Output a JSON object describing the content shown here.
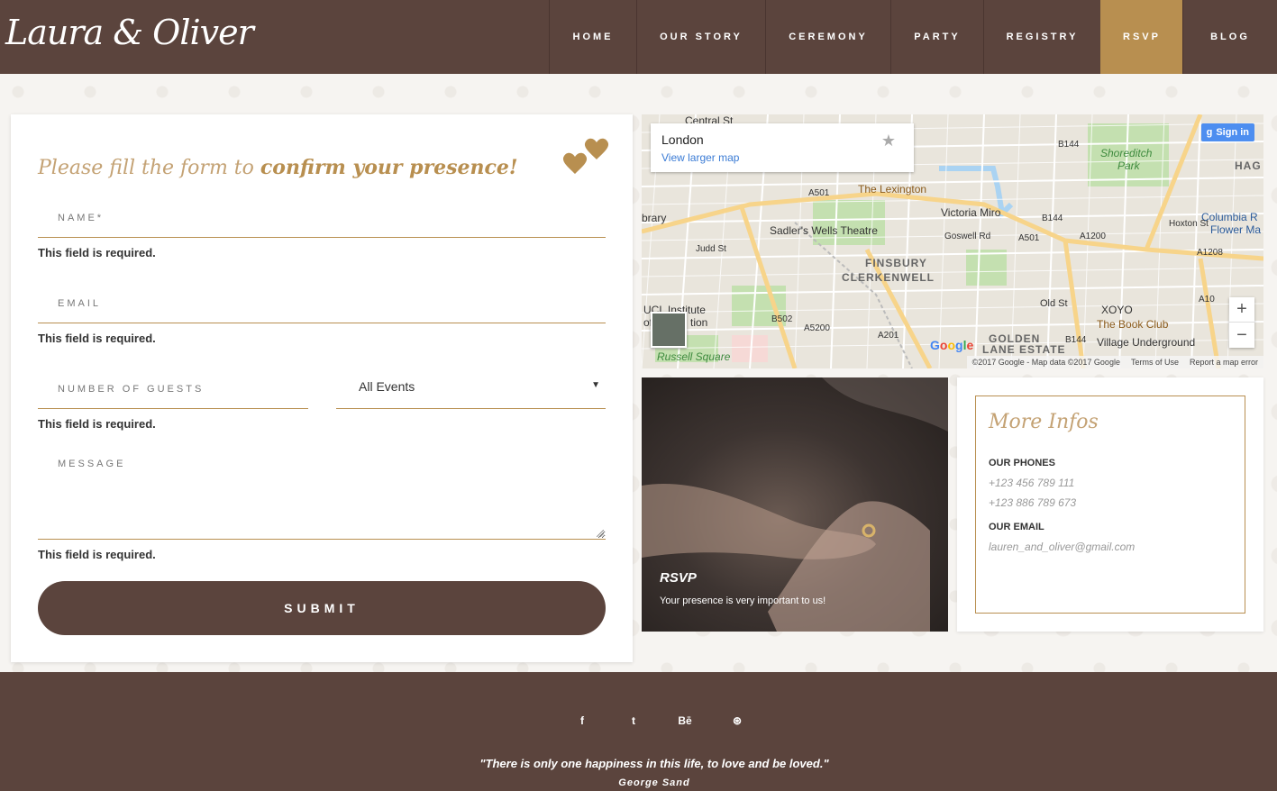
{
  "header": {
    "logo": "Laura & Oliver",
    "nav": [
      {
        "label": "HOME",
        "active": false
      },
      {
        "label": "OUR STORY",
        "active": false
      },
      {
        "label": "CEREMONY",
        "active": false
      },
      {
        "label": "PARTY",
        "active": false
      },
      {
        "label": "REGISTRY",
        "active": false
      },
      {
        "label": "RSVP",
        "active": true
      },
      {
        "label": "BLOG",
        "active": false
      }
    ]
  },
  "form": {
    "title_plain": "Please fill the form to",
    "title_strong": "confirm your presence!",
    "name_label": "NAME*",
    "email_label": "EMAIL",
    "guests_label": "NUMBER OF GUESTS",
    "event_select": "All Events",
    "message_label": "MESSAGE",
    "error_text": "This field is required.",
    "submit_label": "SUBMIT"
  },
  "map": {
    "place": "London",
    "view_larger": "View larger map",
    "sign_in": "Sign in",
    "zoom_in": "+",
    "zoom_out": "−",
    "google": "Google",
    "copyright": "©2017 Google - Map data ©2017 Google",
    "terms": "Terms of Use",
    "report": "Report a map error",
    "labels": {
      "central_st": "Central St",
      "the_lexington": "The Lexington",
      "victoria_miro": "Victoria Miro",
      "sadlers_wells": "Sadler's Wells Theatre",
      "finsbury": "FINSBURY",
      "clerkenwell": "CLERKENWELL",
      "shoreditch": "Shoreditch",
      "park": "Park",
      "columbia": "Columbia R",
      "flower": "Flower Ma",
      "xoyo": "XOYO",
      "book_club": "The Book Club",
      "village": "Village Underground",
      "golden": "GOLDEN",
      "lane_estate": "LANE ESTATE",
      "russell": "Russell Square",
      "ucl": "UCL Institute",
      "of": "of",
      "tion": "tion",
      "brary": "brary",
      "hag": "HAG",
      "a501a": "A501",
      "a501b": "A501",
      "a201": "A201",
      "b502": "B502",
      "a5200": "A5200",
      "a1200": "A1200",
      "a10": "A10",
      "a1208": "A1208",
      "b144": "B144",
      "b144b": "B144",
      "b144c": "B144",
      "old_st": "Old St",
      "goswell": "Goswell Rd",
      "judd": "Judd St",
      "hoxton": "Hoxton St"
    }
  },
  "photo": {
    "title": "RSVP",
    "subtitle": "Your presence is very important to us!"
  },
  "info": {
    "title": "More Infos",
    "phones_heading": "OUR PHONES",
    "phone1": "+123 456 789 111",
    "phone2": "+123 886 789 673",
    "email_heading": "OUR EMAIL",
    "email": "lauren_and_oliver@gmail.com"
  },
  "footer": {
    "social": [
      {
        "icon": "facebook-icon",
        "glyph": "f"
      },
      {
        "icon": "twitter-icon",
        "glyph": "t"
      },
      {
        "icon": "behance-icon",
        "glyph": "Bē"
      },
      {
        "icon": "dribbble-icon",
        "glyph": "⊛"
      }
    ],
    "quote": "\"There is only one happiness in this life, to love and be loved.\"",
    "author": "George Sand"
  },
  "colors": {
    "brown": "#5b443d",
    "gold": "#b88f50",
    "light_gold": "#c4a274"
  }
}
